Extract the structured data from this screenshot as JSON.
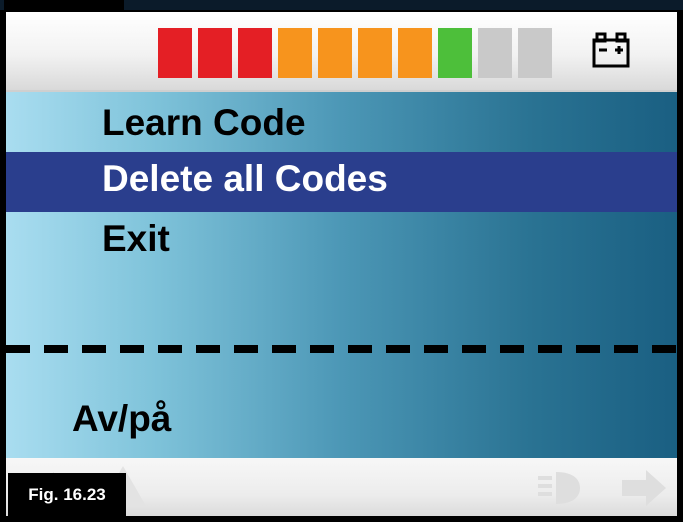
{
  "header": {
    "battery_segments": [
      {
        "color": "#e41f25"
      },
      {
        "color": "#e41f25"
      },
      {
        "color": "#e41f25"
      },
      {
        "color": "#f7941d"
      },
      {
        "color": "#f7941d"
      },
      {
        "color": "#f7941d"
      },
      {
        "color": "#f7941d"
      },
      {
        "color": "#4dbf3a"
      },
      {
        "color": "#c9c9c9"
      },
      {
        "color": "#c9c9c9"
      }
    ],
    "battery_icon": "battery-icon"
  },
  "menu": {
    "items": [
      {
        "label": "Learn Code",
        "selected": false
      },
      {
        "label": "Delete all Codes",
        "selected": true
      },
      {
        "label": "Exit",
        "selected": false
      }
    ]
  },
  "status_label": "Av/på",
  "figure_label": "Fig. 16.23",
  "footer_icons": [
    "left-arrow-icon",
    "warning-triangle-icon",
    "headlight-icon",
    "right-arrow-icon"
  ]
}
